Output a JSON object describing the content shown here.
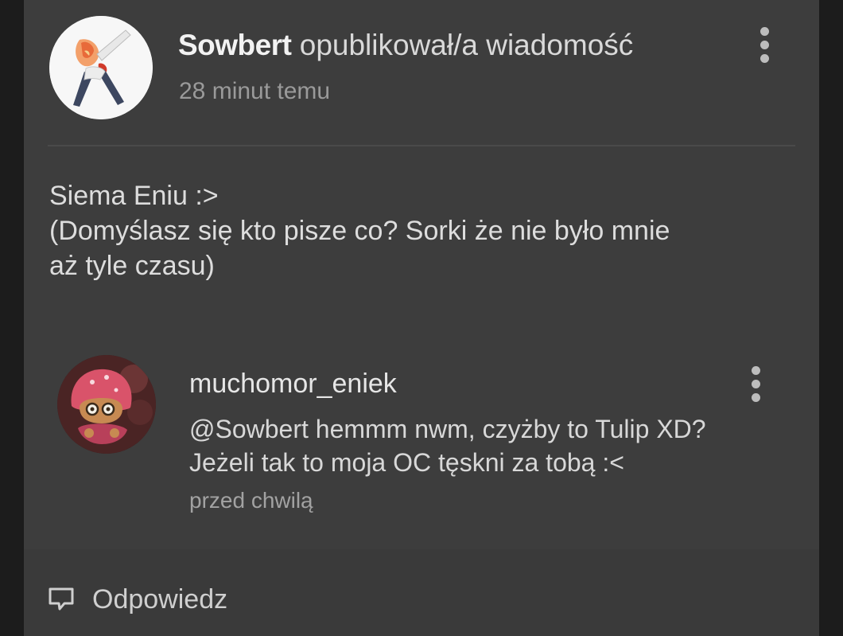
{
  "post": {
    "author": "Sowbert",
    "action": "opublikował/a wiadomość",
    "time": "28 minut temu",
    "message_lines": [
      "Siema Eniu :>",
      "(Domyślasz się kto pisze co?  Sorki że nie było mnie",
      "aż tyle czasu)"
    ],
    "avatar_icon": "anime-character-avatar",
    "menu_icon": "more-vertical-icon"
  },
  "reply": {
    "author": "muchomor_eniek",
    "text_lines": [
      "@Sowbert  hemmm nwm, czyżby to Tulip XD?",
      "Jeżeli tak to moja OC tęskni za tobą :<"
    ],
    "time": "przed chwilą",
    "avatar_icon": "mushroom-cookie-avatar",
    "menu_icon": "more-vertical-icon"
  },
  "footer": {
    "reply_label": "Odpowiedz",
    "reply_icon": "comment-bubble-icon"
  },
  "colors": {
    "card_background": "#3d3d3d",
    "page_background": "#1c1c1c",
    "primary_text": "#dddddd",
    "secondary_text": "#9a9a9a"
  }
}
